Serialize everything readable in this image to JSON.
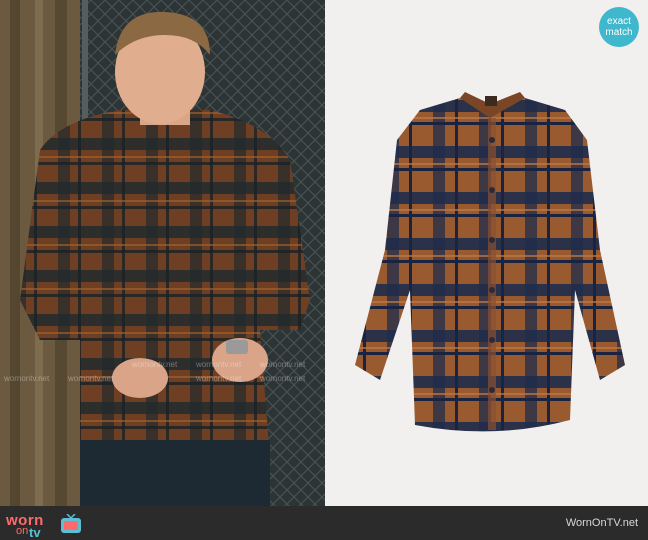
{
  "badge": {
    "line1": "exact",
    "line2": "match",
    "color": "#3fb7cc"
  },
  "watermark": {
    "text": "wornontv.net"
  },
  "footer": {
    "logo": {
      "worn": "worn",
      "on": "on",
      "tv": "tv"
    },
    "site": "WornOnTV.net"
  },
  "colors": {
    "plaid_brown": "#8a4f2c",
    "plaid_navy": "#1c2a4a",
    "accent": "#ff6b6b",
    "teal": "#3fb7cc"
  }
}
